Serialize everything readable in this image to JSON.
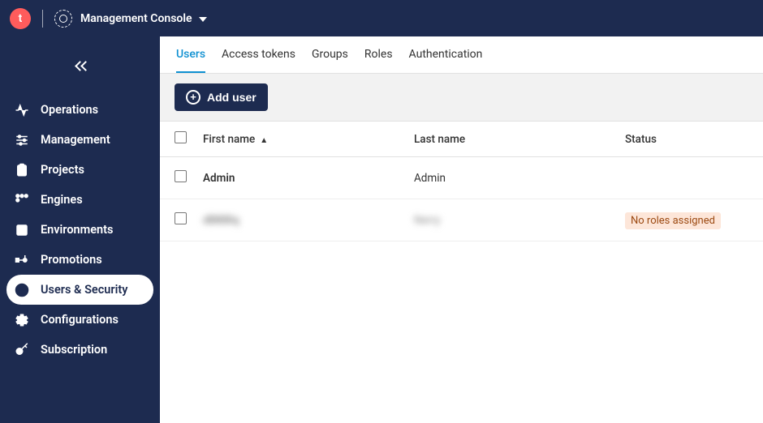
{
  "header": {
    "logo_letter": "t",
    "title": "Management Console"
  },
  "sidebar": {
    "items": [
      {
        "label": "Operations"
      },
      {
        "label": "Management"
      },
      {
        "label": "Projects"
      },
      {
        "label": "Engines"
      },
      {
        "label": "Environments"
      },
      {
        "label": "Promotions"
      },
      {
        "label": "Users & Security"
      },
      {
        "label": "Configurations"
      },
      {
        "label": "Subscription"
      }
    ]
  },
  "tabs": [
    {
      "label": "Users",
      "active": true
    },
    {
      "label": "Access tokens"
    },
    {
      "label": "Groups"
    },
    {
      "label": "Roles"
    },
    {
      "label": "Authentication"
    }
  ],
  "toolbar": {
    "add_user": "Add user"
  },
  "table": {
    "columns": {
      "first": "First name",
      "last": "Last name",
      "status": "Status"
    },
    "rows": [
      {
        "first": "Admin",
        "last": "Admin",
        "status": ""
      },
      {
        "first": "dBBBlq",
        "last": "Nerry",
        "status": "No roles assigned",
        "blurred": true
      }
    ]
  }
}
